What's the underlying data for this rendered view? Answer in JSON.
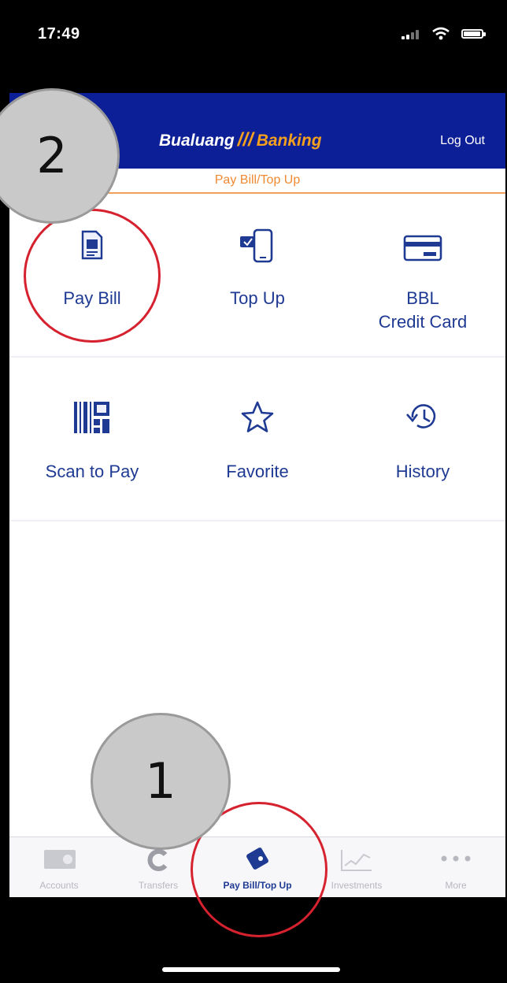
{
  "status_bar": {
    "time": "17:49"
  },
  "header": {
    "brand_part1": "Bualuang",
    "brand_mark": "///",
    "brand_part2": "Banking",
    "logout_label": "Log Out",
    "subtitle": "Pay Bill/Top Up"
  },
  "menu": {
    "items": [
      {
        "label": "Pay Bill",
        "icon": "bill-document-icon"
      },
      {
        "label": "Top Up",
        "icon": "mobile-topup-icon"
      },
      {
        "label": "BBL\nCredit Card",
        "icon": "credit-card-icon"
      },
      {
        "label": "Scan to Pay",
        "icon": "barcode-icon"
      },
      {
        "label": "Favorite",
        "icon": "star-icon"
      },
      {
        "label": "History",
        "icon": "history-icon"
      }
    ]
  },
  "tab_bar": {
    "tabs": [
      {
        "label": "Accounts",
        "icon": "accounts-icon"
      },
      {
        "label": "Transfers",
        "icon": "transfers-icon"
      },
      {
        "label": "Pay Bill/Top Up",
        "icon": "wallet-icon",
        "active": true
      },
      {
        "label": "Investments",
        "icon": "chart-icon"
      },
      {
        "label": "More",
        "icon": "more-dots-icon"
      }
    ]
  },
  "annotations": {
    "marker_1": "1",
    "marker_2": "2"
  },
  "colors": {
    "header_bg": "#0d1f96",
    "accent_orange": "#f08a32",
    "menu_text": "#1f3a93",
    "annotation_ring": "#d6212f"
  }
}
